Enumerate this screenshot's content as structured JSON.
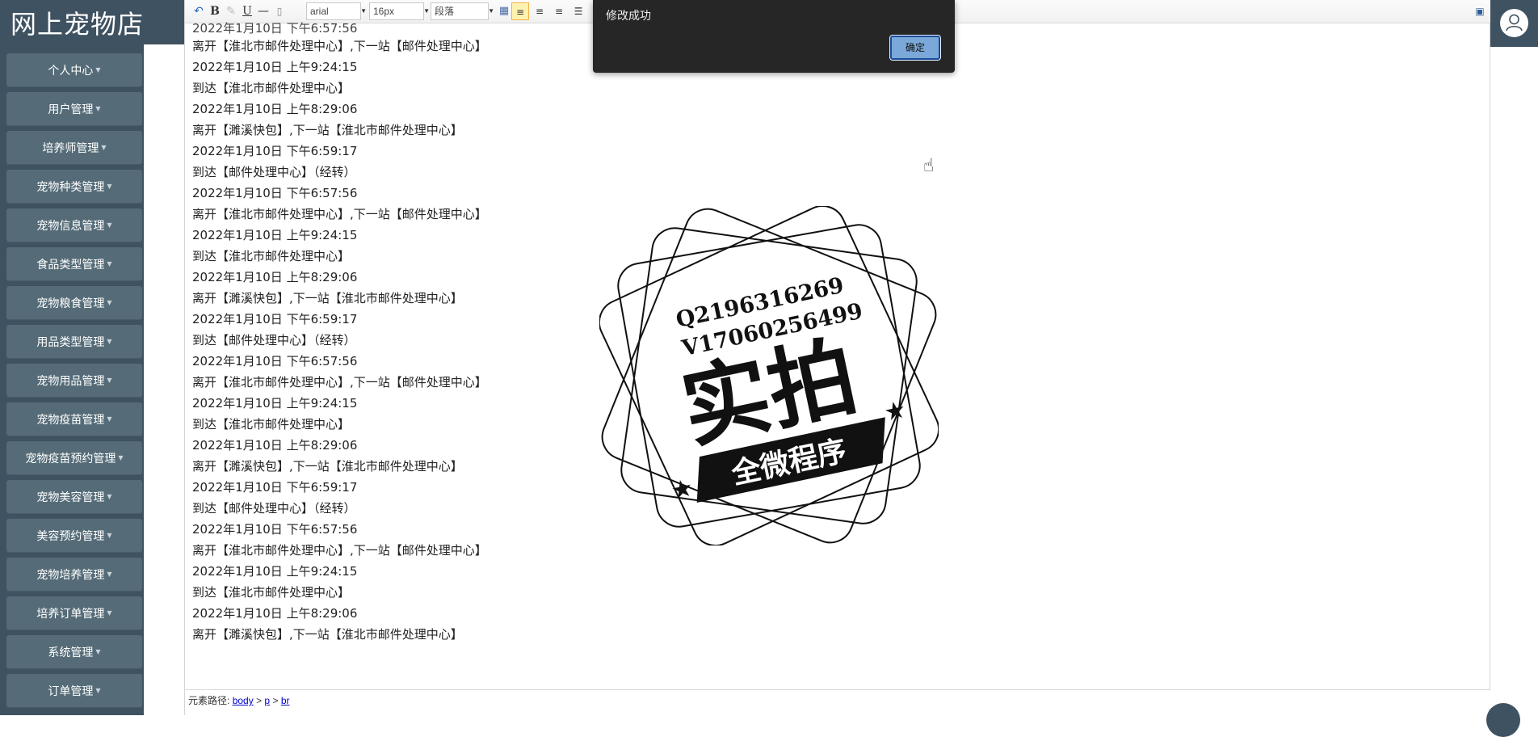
{
  "brand": {
    "title": "网上宠物店"
  },
  "sidebar": {
    "items": [
      {
        "label": "个人中心"
      },
      {
        "label": "用户管理"
      },
      {
        "label": "培养师管理"
      },
      {
        "label": "宠物种类管理"
      },
      {
        "label": "宠物信息管理"
      },
      {
        "label": "食品类型管理"
      },
      {
        "label": "宠物粮食管理"
      },
      {
        "label": "用品类型管理"
      },
      {
        "label": "宠物用品管理"
      },
      {
        "label": "宠物疫苗管理"
      },
      {
        "label": "宠物疫苗预约管理"
      },
      {
        "label": "宠物美容管理"
      },
      {
        "label": "美容预约管理"
      },
      {
        "label": "宠物培养管理"
      },
      {
        "label": "培养订单管理"
      },
      {
        "label": "系统管理"
      },
      {
        "label": "订单管理"
      }
    ]
  },
  "toolbar": {
    "bold": "B",
    "underline": "U",
    "font_family": "arial",
    "font_size": "16px",
    "paragraph": "段落"
  },
  "content": {
    "lines": [
      "离开【淮北市邮件处理中心】,下一站【邮件处理中心】",
      "2022年1月10日 上午9:24:15",
      "到达【淮北市邮件处理中心】",
      "2022年1月10日 上午8:29:06",
      "离开【濉溪快包】,下一站【淮北市邮件处理中心】",
      "2022年1月10日 下午6:59:17",
      "到达【邮件处理中心】（经转）",
      "2022年1月10日 下午6:57:56",
      "离开【淮北市邮件处理中心】,下一站【邮件处理中心】",
      "2022年1月10日 上午9:24:15",
      "到达【淮北市邮件处理中心】",
      "2022年1月10日 上午8:29:06",
      "离开【濉溪快包】,下一站【淮北市邮件处理中心】",
      "2022年1月10日 下午6:59:17",
      "到达【邮件处理中心】（经转）",
      "2022年1月10日 下午6:57:56",
      "离开【淮北市邮件处理中心】,下一站【邮件处理中心】",
      "2022年1月10日 上午9:24:15",
      "到达【淮北市邮件处理中心】",
      "2022年1月10日 上午8:29:06",
      "离开【濉溪快包】,下一站【淮北市邮件处理中心】",
      "2022年1月10日 下午6:59:17",
      "到达【邮件处理中心】（经转）",
      "2022年1月10日 下午6:57:56",
      "离开【淮北市邮件处理中心】,下一站【邮件处理中心】",
      "2022年1月10日 上午9:24:15",
      "到达【淮北市邮件处理中心】",
      "2022年1月10日 上午8:29:06",
      "离开【濉溪快包】,下一站【淮北市邮件处理中心】"
    ]
  },
  "statusbar": {
    "label": "元素路径:",
    "path": [
      "body",
      "p",
      "br"
    ],
    "sep": ">"
  },
  "dialog": {
    "message": "修改成功",
    "ok_label": "确定"
  },
  "watermark": {
    "qq": "Q2196316269",
    "vx": "V17060256499",
    "main": "实拍",
    "ribbon": "全微程序"
  },
  "colors": {
    "sidebar_bg": "#3f5261",
    "nav_item_bg": "#556c78",
    "dialog_bg": "#262626",
    "accent_button": "#7aa8d8"
  },
  "icons": {
    "undo": "undo-icon",
    "user": "user-icon",
    "fullscreen": "fullscreen-icon"
  }
}
